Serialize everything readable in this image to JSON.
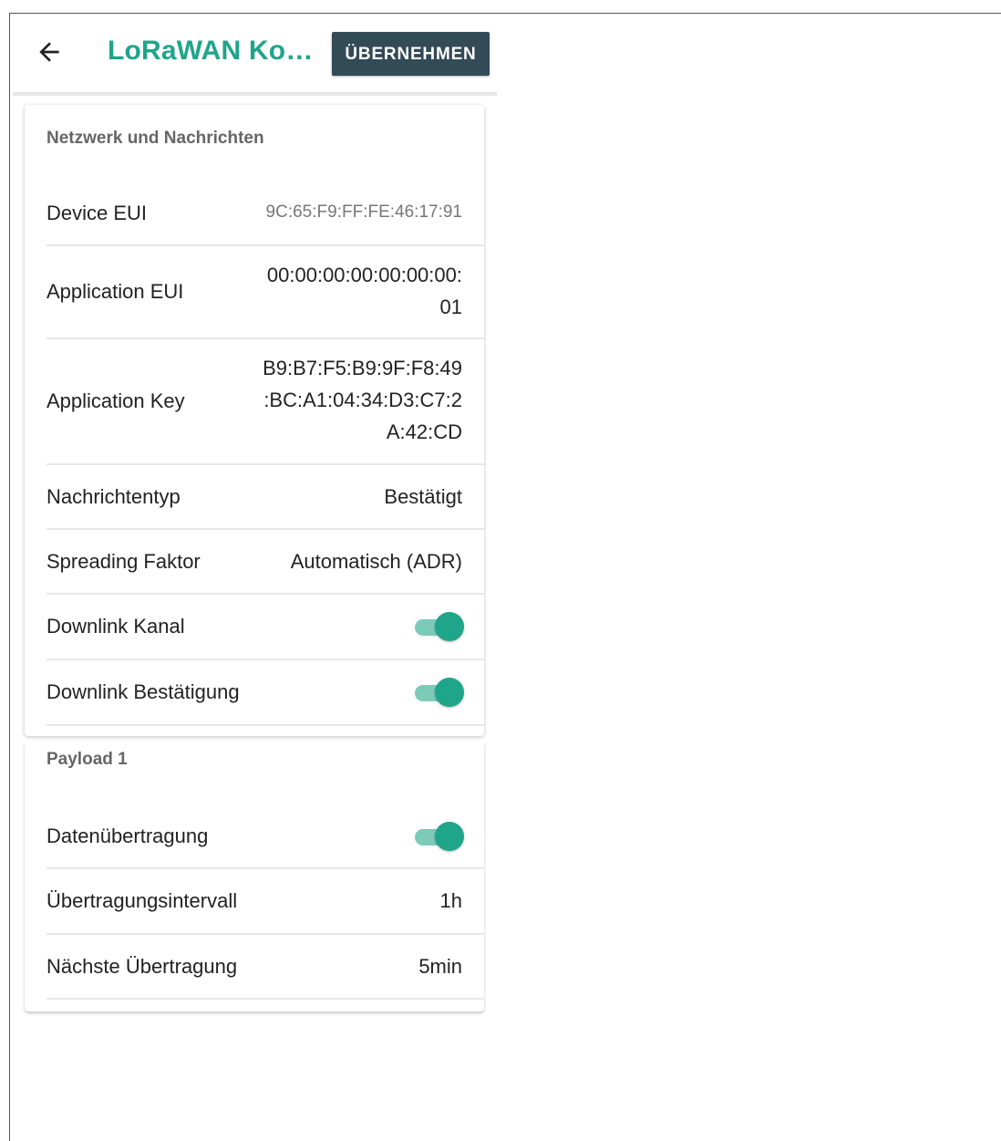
{
  "appbar": {
    "title": "LoRaWAN Ko…",
    "apply_label": "ÜBERNEHMEN",
    "back_icon": "arrow-left-icon"
  },
  "network": {
    "section_title": "Netzwerk und Nachrichten",
    "device_eui": {
      "label": "Device EUI",
      "value": "9C:65:F9:FF:FE:46:17:91"
    },
    "application_eui": {
      "label": "Application EUI",
      "value": "00:00:00:00:00:00:00:\n01"
    },
    "application_key": {
      "label": "Application Key",
      "value": "B9:B7:F5:B9:9F:F8:49\n:BC:A1:04:34:D3:C7:2\nA:42:CD"
    },
    "message_type": {
      "label": "Nachrichtentyp",
      "value": "Bestätigt"
    },
    "spreading_factor": {
      "label": "Spreading Faktor",
      "value": "Automatisch (ADR)"
    },
    "downlink_channel": {
      "label": "Downlink Kanal",
      "enabled": true
    },
    "downlink_ack": {
      "label": "Downlink Bestätigung",
      "enabled": true
    }
  },
  "payload": {
    "section_title": "Payload 1",
    "data_transfer": {
      "label": "Datenübertragung",
      "enabled": true
    },
    "interval": {
      "label": "Übertragungsintervall",
      "value": "1h"
    },
    "next": {
      "label": "Nächste Übertragung",
      "value": "5min"
    }
  },
  "colors": {
    "accent": "#1fa58a",
    "button_bg": "#334a57",
    "toggle_track": "#7ccab8"
  }
}
